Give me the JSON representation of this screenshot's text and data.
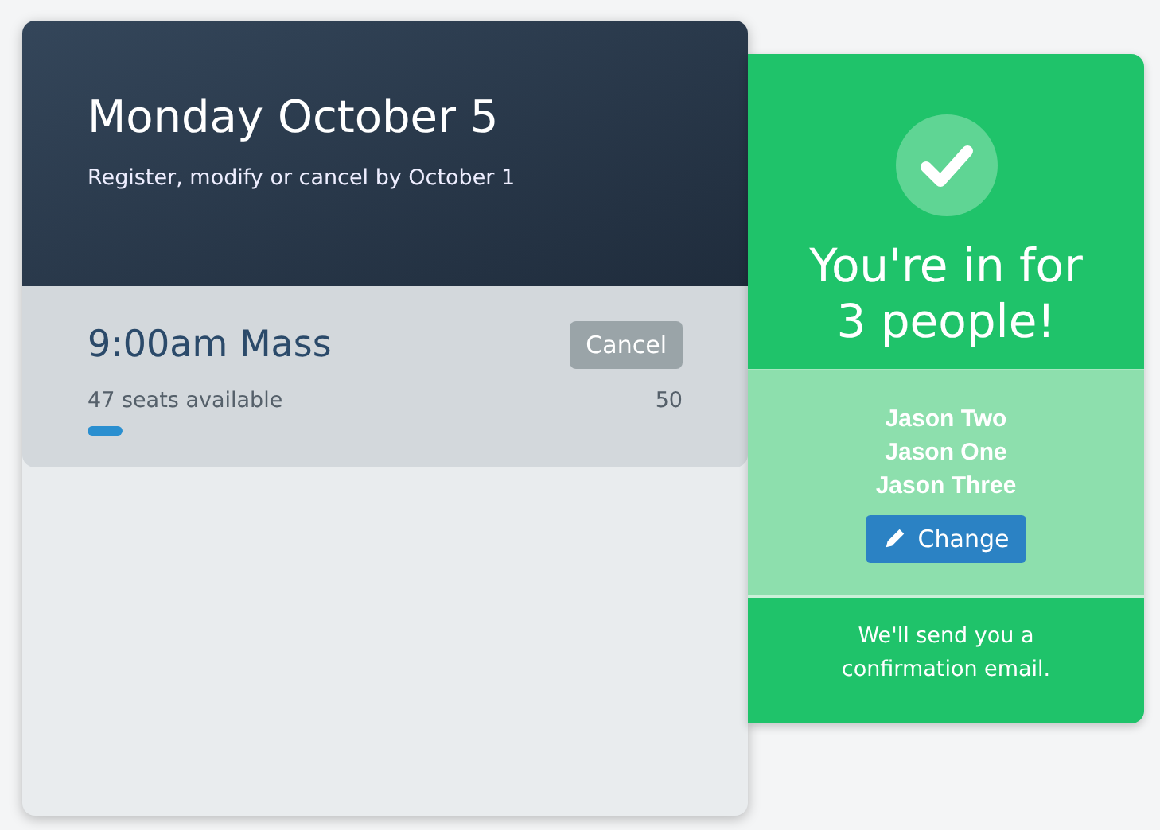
{
  "event": {
    "title": "Monday October 5",
    "subtitle": "Register, modify or cancel by October 1"
  },
  "session": {
    "name": "9:00am Mass",
    "cancel_label": "Cancel",
    "seats_text": "47 seats available",
    "capacity": "50",
    "level": 0.06
  },
  "confirmation": {
    "heading": "You're in for 3 people!",
    "people": [
      "Jason Two",
      "Jason One",
      "Jason Three"
    ],
    "change_label": "Change",
    "note": "We'll send you a confirmation email."
  }
}
